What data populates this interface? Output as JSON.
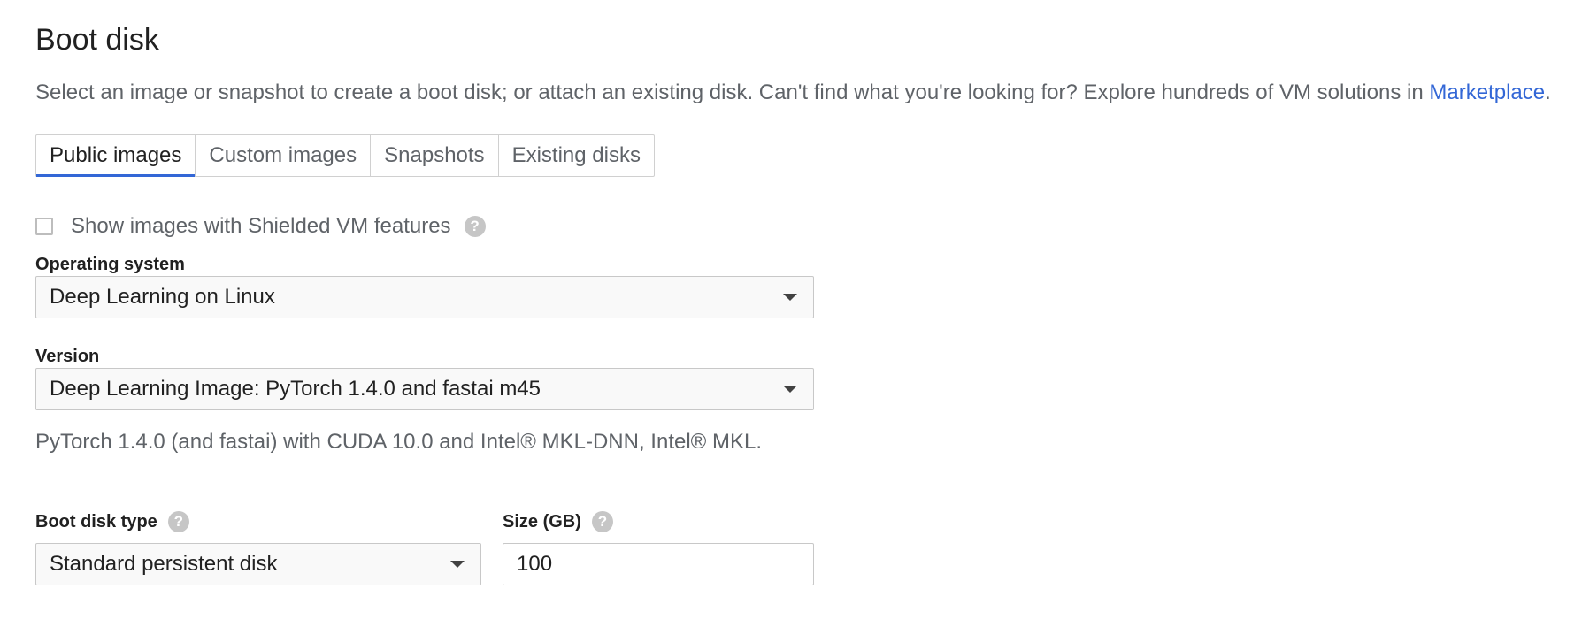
{
  "section": {
    "title": "Boot disk",
    "description": "Select an image or snapshot to create a boot disk; or attach an existing disk. Can't find what you're looking for? Explore hundreds of VM solutions in ",
    "marketplace_link": "Marketplace",
    "description_end": "."
  },
  "tabs": [
    {
      "label": "Public images",
      "active": true
    },
    {
      "label": "Custom images",
      "active": false
    },
    {
      "label": "Snapshots",
      "active": false
    },
    {
      "label": "Existing disks",
      "active": false
    }
  ],
  "shielded_vm": {
    "label": "Show images with Shielded VM features",
    "checked": false,
    "help_icon": "question-circle-icon"
  },
  "operating_system": {
    "label": "Operating system",
    "value": "Deep Learning on Linux"
  },
  "version": {
    "label": "Version",
    "value": "Deep Learning Image: PyTorch 1.4.0 and fastai m45",
    "description": "PyTorch 1.4.0 (and fastai) with CUDA 10.0 and Intel® MKL-DNN, Intel® MKL."
  },
  "boot_disk_type": {
    "label": "Boot disk type",
    "value": "Standard persistent disk",
    "help_icon": "question-circle-icon"
  },
  "size": {
    "label": "Size (GB)",
    "value": "100",
    "help_icon": "question-circle-icon"
  },
  "colors": {
    "link": "#3367d6",
    "active_tab_underline": "#3367d6",
    "help_icon_bg": "#c6c6c6"
  }
}
